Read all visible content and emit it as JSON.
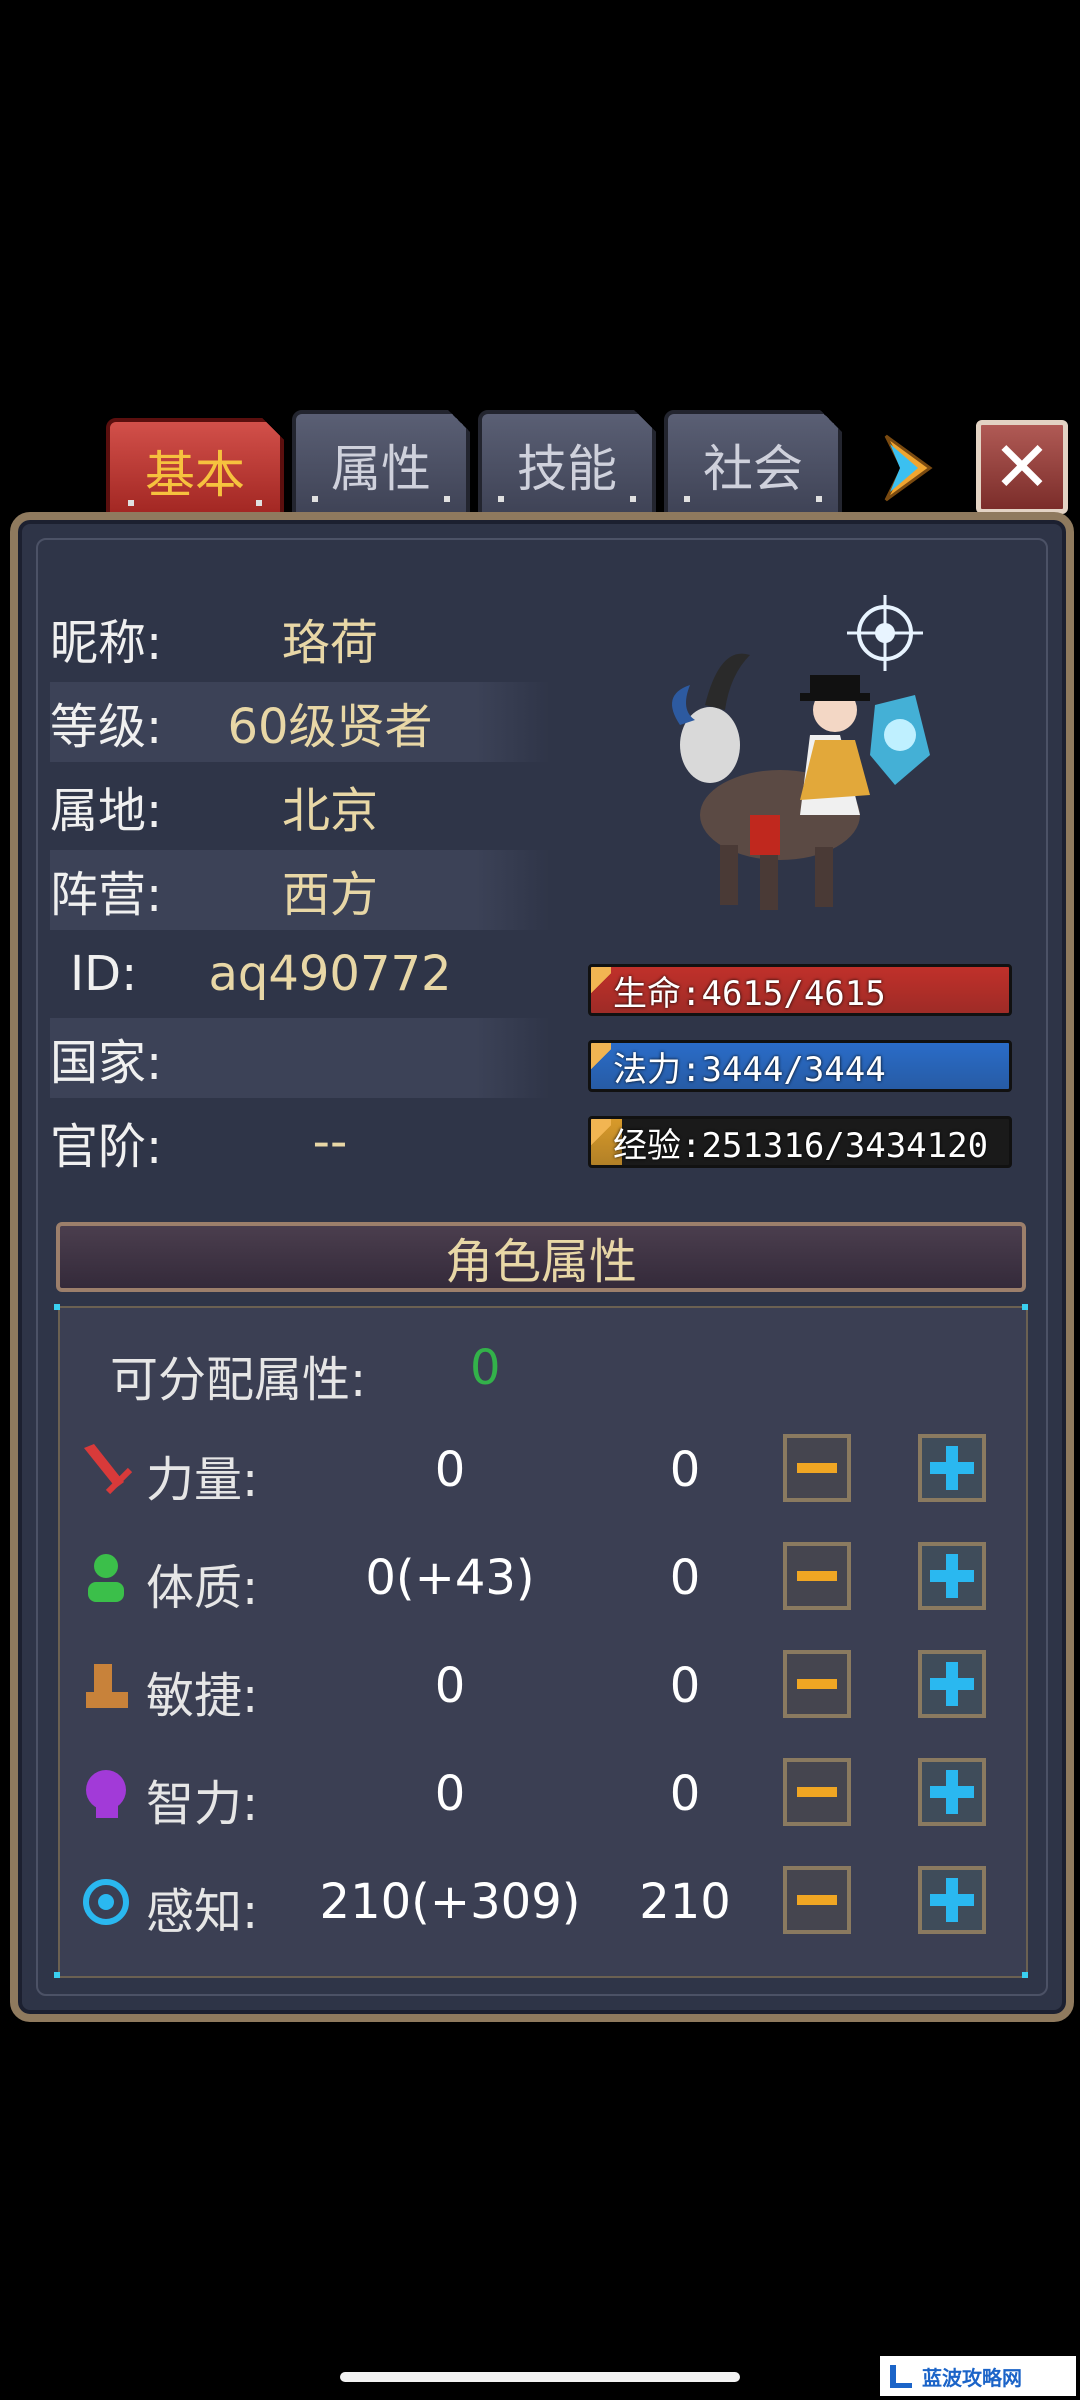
{
  "tabs": [
    {
      "label": "基本",
      "active": true
    },
    {
      "label": "属性",
      "active": false
    },
    {
      "label": "技能",
      "active": false
    },
    {
      "label": "社会",
      "active": false
    }
  ],
  "info": {
    "nickname_label": "昵称:",
    "nickname": "珞荷",
    "level_label": "等级:",
    "level": "60级贤者",
    "home_label": "属地:",
    "home": "北京",
    "camp_label": "阵营:",
    "camp": "西方",
    "id_label": "ID:",
    "id": "aq490772",
    "country_label": "国家:",
    "country": "",
    "rank_label": "官阶:",
    "rank": "--"
  },
  "bars": {
    "hp": {
      "text": "生命:4615/4615",
      "fraction": 1.0,
      "color": "#c0302a"
    },
    "mp": {
      "text": "法力:3444/3444",
      "fraction": 1.0,
      "color": "#2a6cc8"
    },
    "exp": {
      "text": "经验:251316/3434120",
      "fraction": 0.073,
      "color": "#d89a2a"
    }
  },
  "attributes": {
    "header": "角色属性",
    "allocatable_label": "可分配属性:",
    "allocatable_value": "0",
    "rows": [
      {
        "name": "力量:",
        "value": "0",
        "added": "0",
        "icon": "sword-icon"
      },
      {
        "name": "体质:",
        "value": "0(+43)",
        "added": "0",
        "icon": "person-icon"
      },
      {
        "name": "敏捷:",
        "value": "0",
        "added": "0",
        "icon": "boot-icon"
      },
      {
        "name": "智力:",
        "value": "0",
        "added": "0",
        "icon": "head-icon"
      },
      {
        "name": "感知:",
        "value": "210(+309)",
        "added": "210",
        "icon": "eye-icon"
      }
    ]
  },
  "watermark": {
    "text": "蓝波攻略网"
  }
}
